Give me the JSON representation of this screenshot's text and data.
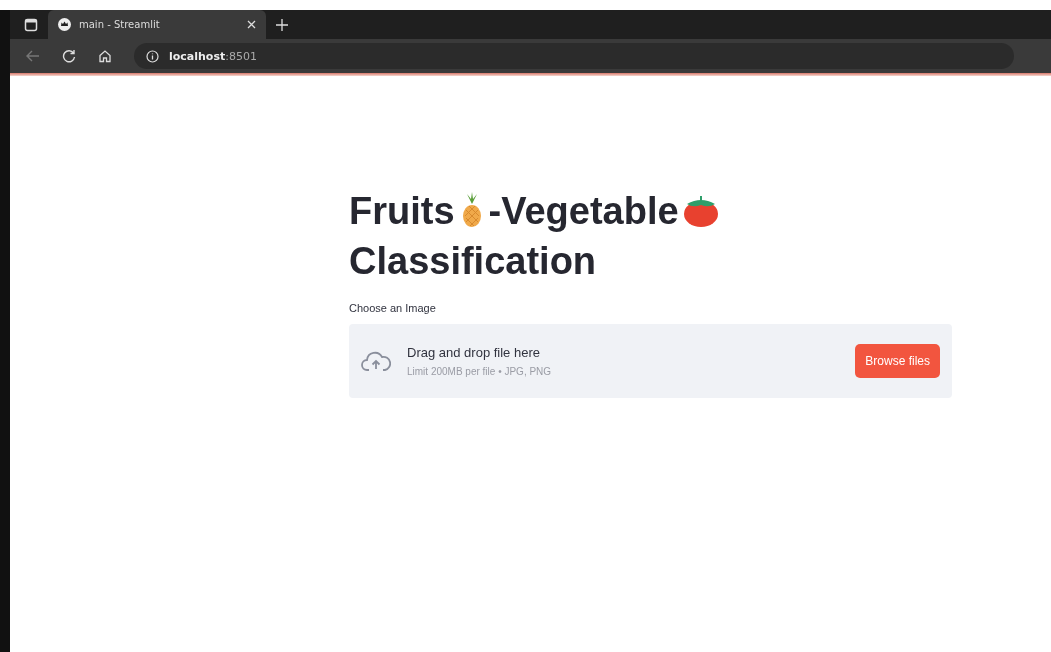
{
  "browser": {
    "tab": {
      "title": "main - Streamlit",
      "selected": true
    },
    "address": {
      "host": "localhost",
      "port": ":8501"
    }
  },
  "page": {
    "title": [
      "Fruits",
      "-Vegetable",
      "Classification"
    ],
    "uploader": {
      "label": "Choose an Image",
      "drop_text": "Drag and drop file here",
      "limit_text": "Limit 200MB per file • JPG, PNG",
      "button": "Browse files"
    }
  }
}
